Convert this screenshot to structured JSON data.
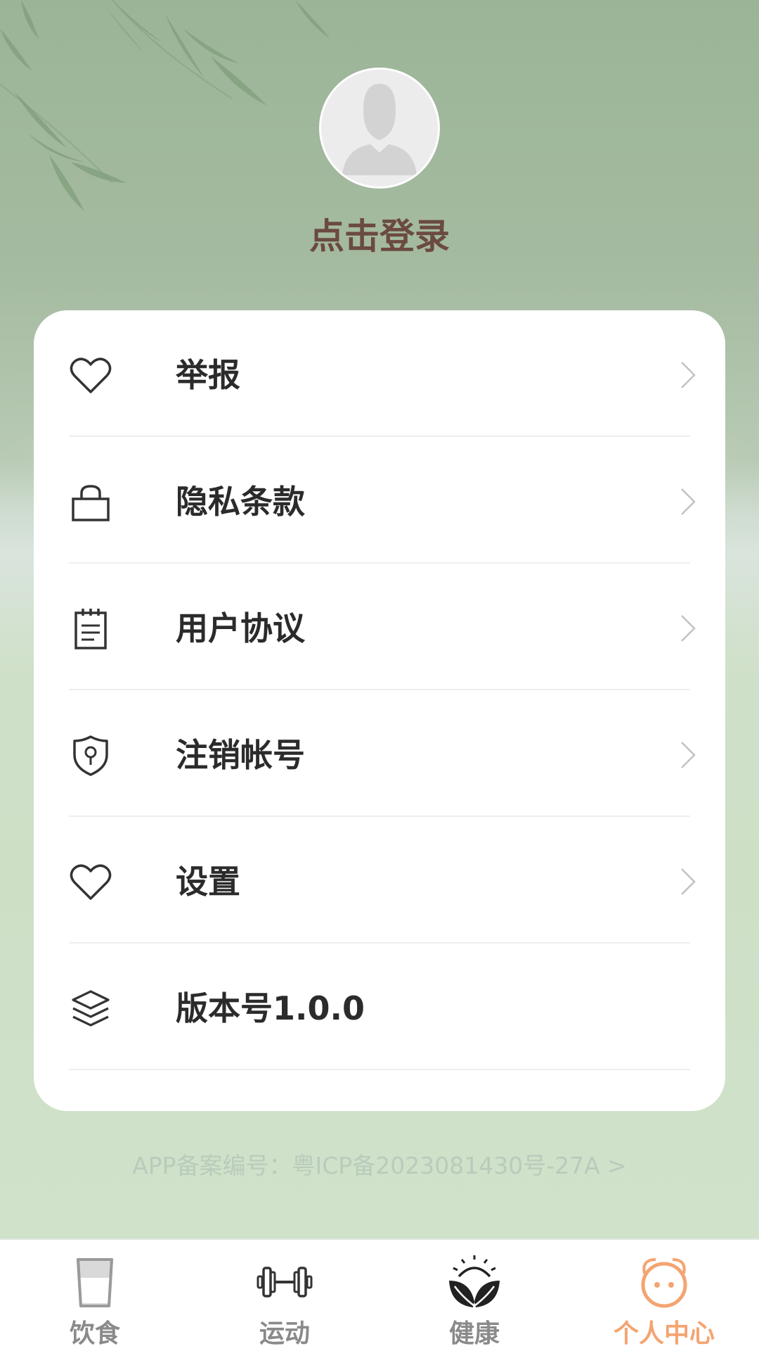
{
  "profile": {
    "login_text": "点击登录"
  },
  "menu": {
    "items": [
      {
        "label": "举报",
        "icon": "heart-icon"
      },
      {
        "label": "隐私条款",
        "icon": "lock-icon"
      },
      {
        "label": "用户协议",
        "icon": "notepad-icon"
      },
      {
        "label": "注销帐号",
        "icon": "shield-keyhole-icon"
      },
      {
        "label": "设置",
        "icon": "heart-icon"
      },
      {
        "label": "版本号1.0.0",
        "icon": "layers-icon"
      }
    ]
  },
  "footer": {
    "icp_text": "APP备案编号：粤ICP备2023081430号-27A >"
  },
  "tabbar": {
    "tabs": [
      {
        "label": "饮食",
        "icon": "cup-icon"
      },
      {
        "label": "运动",
        "icon": "dumbbell-icon"
      },
      {
        "label": "健康",
        "icon": "leaves-sun-icon"
      },
      {
        "label": "个人中心",
        "icon": "face-icon"
      }
    ],
    "active_index": 3
  },
  "colors": {
    "accent": "#f4a471",
    "login_text": "#6b4a40",
    "tab_inactive": "#8a8a8a"
  }
}
